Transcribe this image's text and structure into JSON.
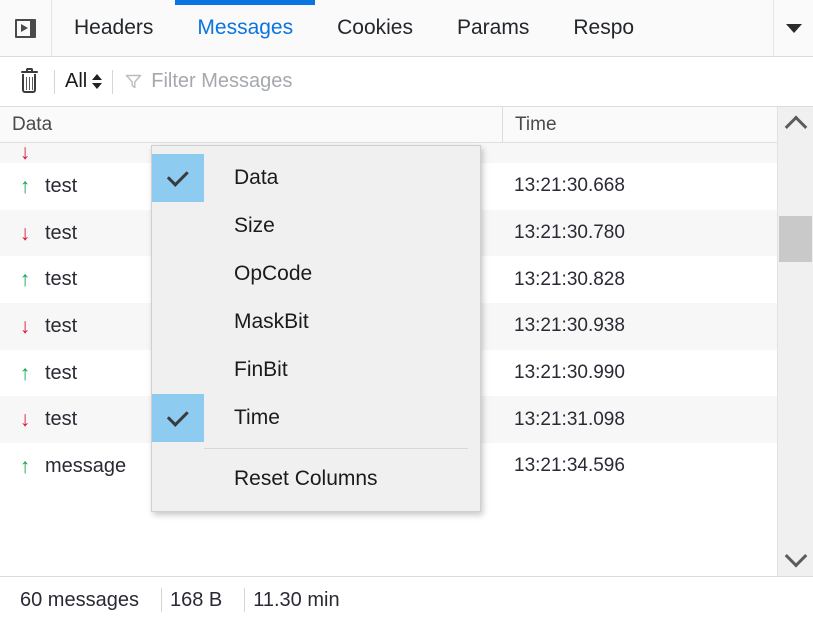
{
  "tabbar": {
    "sidebar_toggle_icon": "sidebar-toggle-icon",
    "overflow_icon": "chevron-down-icon",
    "tabs": [
      {
        "label": "Headers",
        "active": false
      },
      {
        "label": "Messages",
        "active": true
      },
      {
        "label": "Cookies",
        "active": false
      },
      {
        "label": "Params",
        "active": false
      },
      {
        "label": "Respo",
        "active": false
      }
    ],
    "active_tab": "Messages",
    "accent_color": "#0a74e0"
  },
  "toolbar": {
    "clear_icon": "trash-icon",
    "clear_label": "Clear",
    "type_filter_value": "All",
    "type_filter_icon": "spinner-arrows-icon",
    "filter_icon": "funnel-icon",
    "filter_placeholder": "Filter Messages",
    "filter_value": ""
  },
  "table": {
    "columns": [
      {
        "key": "data",
        "label": "Data"
      },
      {
        "key": "time",
        "label": "Time"
      }
    ],
    "rows": [
      {
        "direction": "",
        "arrow": "",
        "data": "",
        "time": "",
        "partial": true
      },
      {
        "direction": "sent",
        "arrow": "↑",
        "data": "test",
        "time": "13:21:30.668"
      },
      {
        "direction": "recv",
        "arrow": "↓",
        "data": "test",
        "time": "13:21:30.780"
      },
      {
        "direction": "sent",
        "arrow": "↑",
        "data": "test",
        "time": "13:21:30.828"
      },
      {
        "direction": "recv",
        "arrow": "↓",
        "data": "test",
        "time": "13:21:30.938"
      },
      {
        "direction": "sent",
        "arrow": "↑",
        "data": "test",
        "time": "13:21:30.990"
      },
      {
        "direction": "recv",
        "arrow": "↓",
        "data": "test",
        "time": "13:21:31.098"
      },
      {
        "direction": "sent",
        "arrow": "↑",
        "data": "message",
        "time": "13:21:34.596"
      }
    ],
    "sent_color": "#16a34a",
    "received_color": "#dc143c"
  },
  "scrollbar": {
    "up_icon": "chevron-up-icon",
    "down_icon": "chevron-down-icon"
  },
  "context_menu": {
    "items": [
      {
        "label": "Data",
        "checked": true,
        "separator_before": false
      },
      {
        "label": "Size",
        "checked": false,
        "separator_before": false
      },
      {
        "label": "OpCode",
        "checked": false,
        "separator_before": false
      },
      {
        "label": "MaskBit",
        "checked": false,
        "separator_before": false
      },
      {
        "label": "FinBit",
        "checked": false,
        "separator_before": false
      },
      {
        "label": "Time",
        "checked": true,
        "separator_before": false
      },
      {
        "label": "Reset Columns",
        "checked": false,
        "separator_before": true
      }
    ],
    "check_highlight_color": "#8ecbf0"
  },
  "statusbar": {
    "message_count": "60 messages",
    "total_size": "168 B",
    "duration": "11.30 min"
  }
}
